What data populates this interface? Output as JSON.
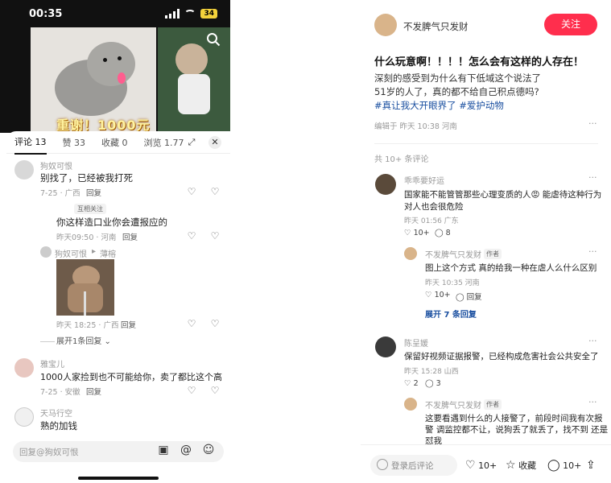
{
  "status": {
    "time": "00:35",
    "battery": "34"
  },
  "video": {
    "promo_text": "重谢！1000元"
  },
  "comment_panel": {
    "tabs": [
      {
        "label": "评论 13"
      },
      {
        "label": "赞 33"
      },
      {
        "label": "收藏 0"
      },
      {
        "label": "浏览 1.77"
      }
    ],
    "comments": [
      {
        "user": "狗奴可恨",
        "text": "别找了，已经被我打死",
        "meta": "7-25 · 广西",
        "reply": "回复"
      },
      {
        "badge": "互相关注",
        "text": "你这样造口业你会遭报应的",
        "meta": "昨天09:50 · 河南",
        "reply": "回复"
      },
      {
        "user": "狗奴可恨",
        "reply_to": "薄榕",
        "meta": "昨天 18:25 · 广西",
        "reply": "回复",
        "expand": "展开1条回复"
      },
      {
        "user": "雅宝儿",
        "text": "1000人家捡到也不可能给你，卖了都比这个高",
        "meta": "7-25 · 安徽",
        "reply": "回复"
      },
      {
        "user": "天马行空",
        "text": "熟的加钱"
      }
    ],
    "input_placeholder": "回复@狗奴可恨"
  },
  "post": {
    "author": "不发脾气只发财",
    "follow": "关注",
    "title": "什么玩意啊！！！！怎么会有这样的人存在！",
    "body_lines": [
      "深刻的感受到为什么有下低域这个说法了",
      "51岁的人了，真的都不给自己积点德吗?"
    ],
    "tags": "#真让我大开眼界了 #爱护动物",
    "meta": "编辑于 昨天 10:38 河南",
    "comment_count": "共 10+ 条评论",
    "comments": [
      {
        "user": "乖乖要好运",
        "lines": [
          "国家能不能管管那些心理变质的人😡 能虐待这种行为",
          "对人也会很危险"
        ],
        "meta": "昨天 01:56 广东",
        "likes": "10+",
        "replies": "8"
      },
      {
        "user": "不发脾气只发财",
        "author_tag": "作者",
        "text": "图上这个方式 真的给我一种在虐人么什么区别",
        "meta": "昨天 10:35 河南",
        "likes": "10+",
        "reply": "回复"
      },
      {
        "expand": "展开 7 条回复"
      },
      {
        "user": "陈呈媛",
        "text": "保留好视频证据报警，已经构成危害社会公共安全了",
        "meta": "昨天 15:28 山西",
        "likes": "2",
        "replies": "3"
      },
      {
        "user": "不发脾气只发财",
        "author_tag": "作者",
        "lines": [
          "这要看遇到什么的人接警了，前段时间我有次报",
          "警 调监控都不让，说狗丢了就丢了，找不到 还是",
          "怼我"
        ]
      }
    ],
    "bottom": {
      "input": "登录后评论",
      "likes": "10+",
      "collect": "收藏",
      "comments": "10+"
    }
  }
}
